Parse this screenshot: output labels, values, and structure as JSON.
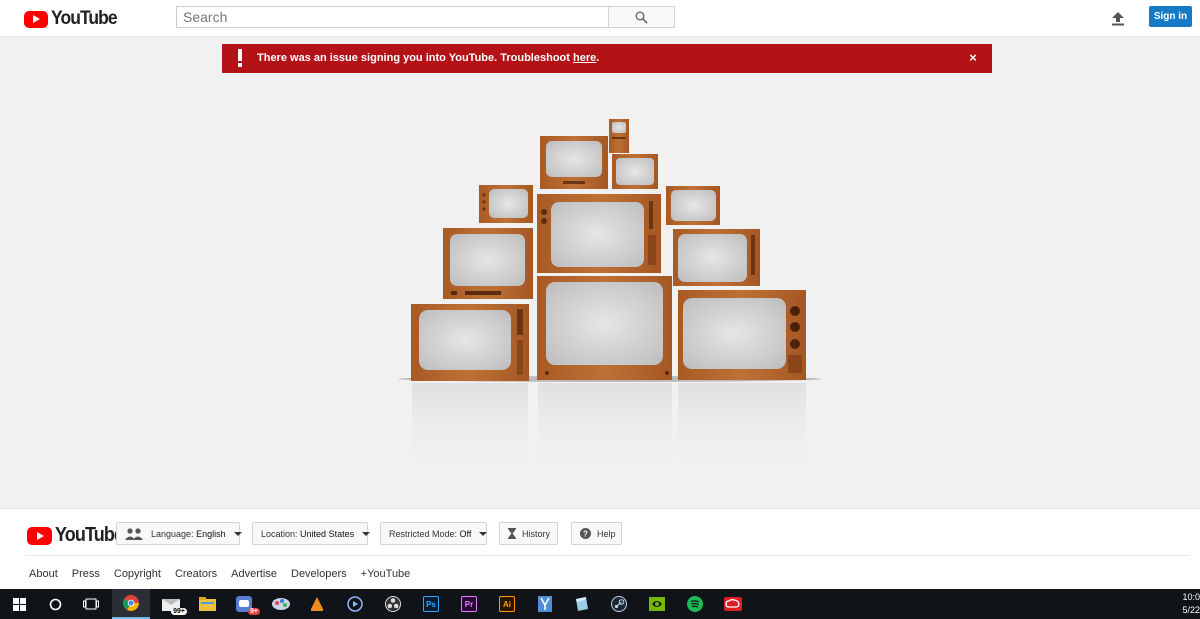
{
  "header": {
    "logo_text": "YouTube",
    "search_placeholder": "Search",
    "signin_label": "Sign in"
  },
  "alert": {
    "message": "There was an issue signing you into YouTube. Troubleshoot ",
    "link_text": "here",
    "suffix": ".",
    "close": "×",
    "color": "#b31217"
  },
  "footer": {
    "logo_text": "YouTube",
    "language_label": "Language:",
    "language_value": "English",
    "location_label": "Location:",
    "location_value": "United States",
    "restricted_label": "Restricted Mode:",
    "restricted_value": "Off",
    "history_label": "History",
    "help_label": "Help",
    "links": [
      "About",
      "Press",
      "Copyright",
      "Creators",
      "Advertise",
      "Developers",
      "+YouTube"
    ]
  },
  "taskbar": {
    "items": [
      {
        "name": "windows-start-icon",
        "label": ""
      },
      {
        "name": "cortana-search-icon",
        "label": ""
      },
      {
        "name": "task-view-icon",
        "label": ""
      },
      {
        "name": "chrome-icon",
        "label": ""
      },
      {
        "name": "mail-app-icon",
        "label": "",
        "badge": "99+"
      },
      {
        "name": "file-explorer-icon",
        "label": ""
      },
      {
        "name": "messaging-app-icon",
        "label": "",
        "badge": "9+"
      },
      {
        "name": "paint-app-icon",
        "label": ""
      },
      {
        "name": "vlc-icon",
        "label": ""
      },
      {
        "name": "media-player-icon",
        "label": ""
      },
      {
        "name": "obs-icon",
        "label": ""
      },
      {
        "name": "photoshop-icon",
        "label": "Ps"
      },
      {
        "name": "premiere-icon",
        "label": "Pr"
      },
      {
        "name": "illustrator-icon",
        "label": "Ai"
      },
      {
        "name": "app-icon-blue",
        "label": ""
      },
      {
        "name": "app-icon-cube",
        "label": ""
      },
      {
        "name": "steam-icon",
        "label": ""
      },
      {
        "name": "nvidia-icon",
        "label": ""
      },
      {
        "name": "spotify-icon",
        "label": ""
      },
      {
        "name": "creative-cloud-icon",
        "label": ""
      }
    ],
    "time": "10:0",
    "date": "5/22"
  },
  "colors": {
    "brand_red": "#ff0000",
    "signin_blue": "#167ac6",
    "tv_wood": "#b0652c"
  }
}
